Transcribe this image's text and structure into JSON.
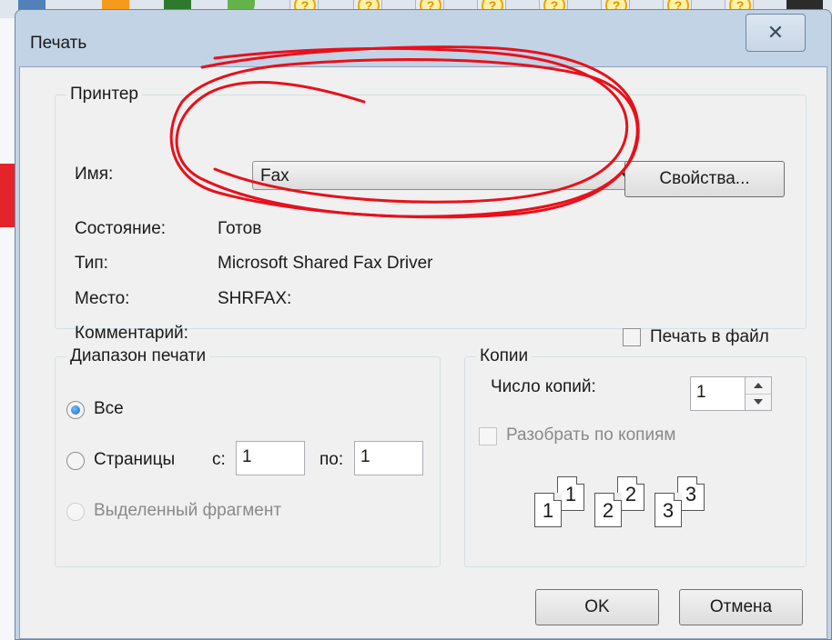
{
  "dialog": {
    "title": "Печать",
    "close_symbol": "✕"
  },
  "printer_group": {
    "title": "Принтер",
    "name_label": "Имя:",
    "name_value": "Fax",
    "properties_button": "Свойства...",
    "status_label": "Состояние:",
    "status_value": "Готов",
    "type_label": "Тип:",
    "type_value": "Microsoft Shared Fax Driver",
    "location_label": "Место:",
    "location_value": "SHRFAX:",
    "comment_label": "Комментарий:",
    "print_to_file_label": "Печать в файл",
    "print_to_file_checked": false
  },
  "range_group": {
    "title": "Диапазон печати",
    "all_label": "Все",
    "all_selected": true,
    "pages_label": "Страницы",
    "from_label": "с:",
    "from_value": "1",
    "to_label": "по:",
    "to_value": "1",
    "selection_label": "Выделенный фрагмент"
  },
  "copies_group": {
    "title": "Копии",
    "count_label": "Число копий:",
    "count_value": "1",
    "collate_label": "Разобрать по копиям",
    "collate_checked": false,
    "collate_pages": [
      "1",
      "1",
      "2",
      "2",
      "3",
      "3"
    ]
  },
  "buttons": {
    "ok": "OK",
    "cancel": "Отмена"
  },
  "taskbar": {
    "icons": [
      "vk-icon",
      "odnoklassniki-icon",
      "green-bug-icon",
      "green-leaf-icon",
      "help-icon",
      "help-icon",
      "help-icon",
      "help-icon",
      "help-icon",
      "help-icon",
      "help-icon",
      "help-icon",
      "help-icon",
      "m-icon"
    ]
  },
  "colors": {
    "annotation_scribble": "#e8101a",
    "titlebar": "#c2d3e6",
    "client": "#f0f0f0"
  }
}
